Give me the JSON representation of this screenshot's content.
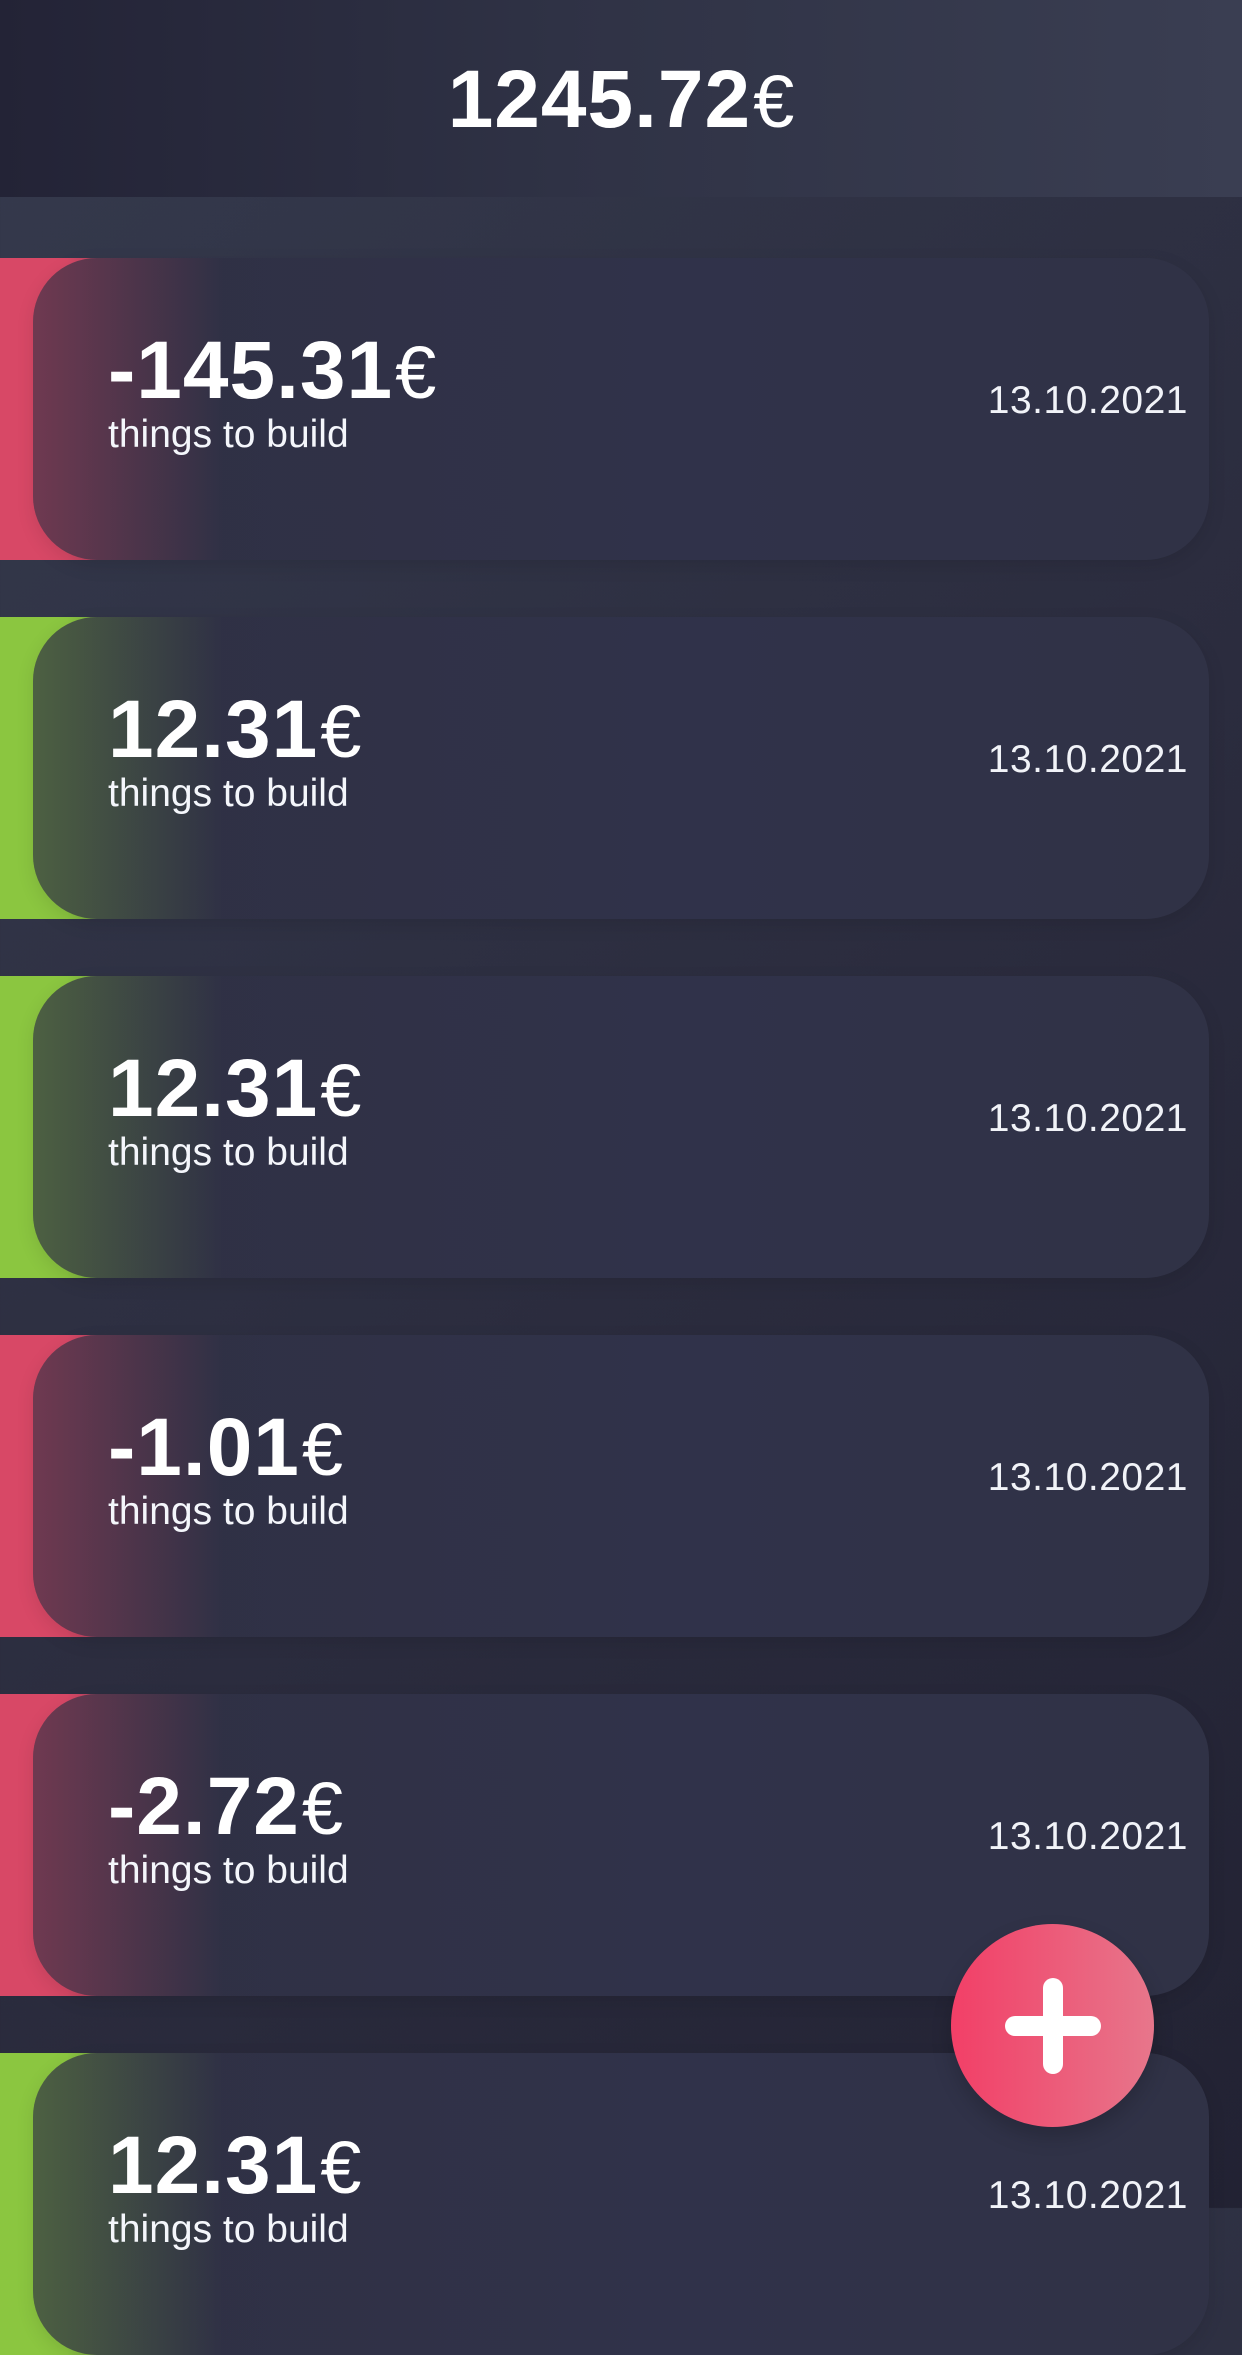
{
  "balance": {
    "amount": "1245.72",
    "currency": "€"
  },
  "transactions": [
    {
      "amount": "-145.31",
      "currency": "€",
      "description": "things to build",
      "date": "13.10.2021"
    },
    {
      "amount": "12.31",
      "currency": "€",
      "description": "things to build",
      "date": "13.10.2021"
    },
    {
      "amount": "12.31",
      "currency": "€",
      "description": "things to build",
      "date": "13.10.2021"
    },
    {
      "amount": "-1.01",
      "currency": "€",
      "description": "things to build",
      "date": "13.10.2021"
    },
    {
      "amount": "-2.72",
      "currency": "€",
      "description": "things to build",
      "date": "13.10.2021"
    },
    {
      "amount": "12.31",
      "currency": "€",
      "description": "things to build",
      "date": "13.10.2021"
    }
  ],
  "fab": {
    "icon": "plus-icon"
  },
  "colors": {
    "negative": "#d84866",
    "positive": "#8bc640",
    "fab": "#f23f67"
  }
}
